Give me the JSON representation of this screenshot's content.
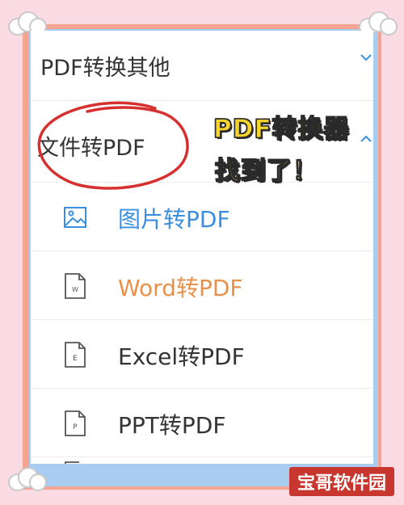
{
  "menu": {
    "section_other": "PDF转换其他",
    "section_file": "文件转PDF",
    "items": [
      {
        "label": "图片转PDF",
        "icon": "image-icon",
        "color": "#3b8fe0"
      },
      {
        "label": "Word转PDF",
        "icon": "word-file-icon",
        "color": "#e8914a"
      },
      {
        "label": "Excel转PDF",
        "icon": "excel-file-icon",
        "color": "#333333"
      },
      {
        "label": "PPT转PDF",
        "icon": "ppt-file-icon",
        "color": "#333333"
      }
    ]
  },
  "overlay": {
    "line1": "PDF转换器",
    "line2": "找到了！"
  },
  "watermark": "宝哥软件园",
  "colors": {
    "background": "#fbdbe3",
    "frame": "#f4a490",
    "frame_inner": "#a9cdf0",
    "circle": "#d63030",
    "banner_text": "#f5d52c",
    "watermark_bg": "#c8372f"
  }
}
